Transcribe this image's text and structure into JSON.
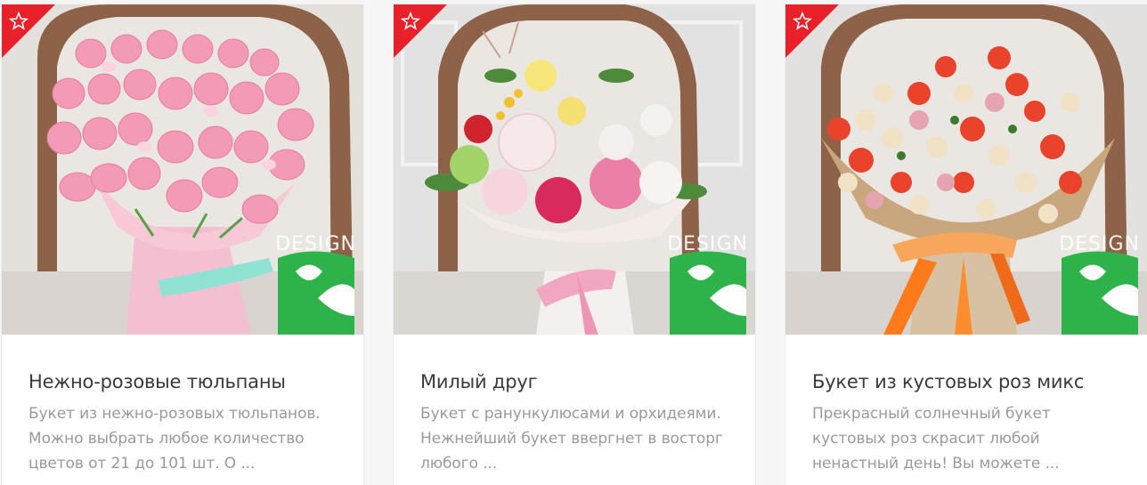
{
  "watermark": "DESIGN",
  "colors": {
    "badge": "#e8202a",
    "logo_green": "#2db34a",
    "title": "#3a3a3a",
    "desc": "#9a9a9a"
  },
  "products": [
    {
      "title": "Нежно-розовые тюльпаны",
      "desc_lines": [
        "Букет из нежно-розовых тюльпанов.",
        "Можно выбрать любое количество",
        "цветов от 21 до 101 шт. О ..."
      ],
      "badge_icon": "star-icon"
    },
    {
      "title": "Милый друг",
      "desc_lines": [
        "Букет с ранункулюсами и орхидеями.",
        "Нежнейший букет ввергнет в восторг",
        "любого ..."
      ],
      "badge_icon": "star-icon"
    },
    {
      "title": "Букет из кустовых роз микс",
      "desc_lines": [
        "Прекрасный солнечный букет",
        "кустовых роз скрасит любой",
        "ненастный день! Вы можете ..."
      ],
      "badge_icon": "star-icon"
    }
  ]
}
